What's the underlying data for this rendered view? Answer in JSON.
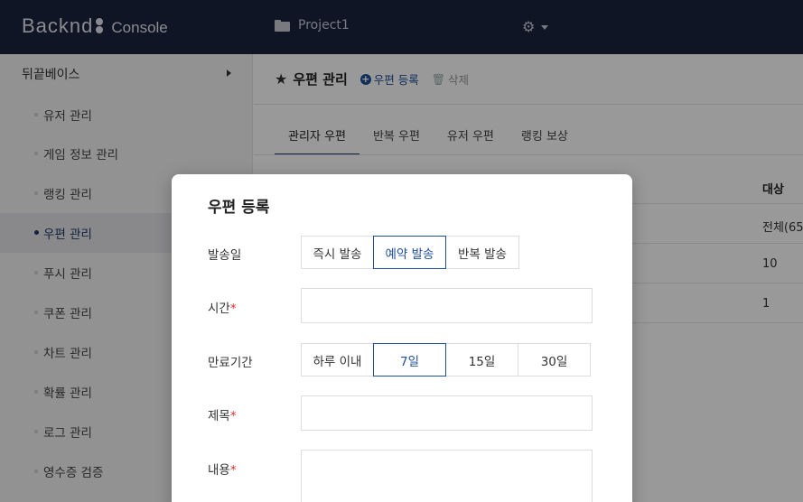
{
  "topbar": {
    "logo_text": "Backnd",
    "console_text": "Console",
    "project_name": "Project1",
    "icons": [
      "folder-icon",
      "gear-icon",
      "caret-down-icon"
    ]
  },
  "sidebar": {
    "group_label": "뒤끝베이스",
    "items": [
      {
        "label": "유저 관리"
      },
      {
        "label": "게임 정보 관리"
      },
      {
        "label": "랭킹 관리"
      },
      {
        "label": "우편 관리",
        "active": true
      },
      {
        "label": "푸시 관리"
      },
      {
        "label": "쿠폰 관리"
      },
      {
        "label": "차트 관리"
      },
      {
        "label": "확률 관리"
      },
      {
        "label": "로그 관리"
      },
      {
        "label": "영수증 검증"
      }
    ]
  },
  "header": {
    "title": "우편 관리",
    "register_label": "우편 등록",
    "delete_label": "삭제"
  },
  "tabs": [
    "관리자 우편",
    "반복 우편",
    "유저 우편",
    "랭킹 보상"
  ],
  "table": {
    "column_header": "대상",
    "rows": [
      "전체(65",
      "10",
      "1"
    ]
  },
  "modal": {
    "title": "우편 등록",
    "send_date": {
      "label": "발송일",
      "options": [
        "즉시 발송",
        "예약 발송",
        "반복 발송"
      ],
      "selected": "예약 발송"
    },
    "time": {
      "label": "시간",
      "required_mark": "*",
      "value": ""
    },
    "expiry": {
      "label": "만료기간",
      "options": [
        "하루 이내",
        "7일",
        "15일",
        "30일"
      ],
      "selected": "7일"
    },
    "subject": {
      "label": "제목",
      "required_mark": "*",
      "value": ""
    },
    "content": {
      "label": "내용",
      "required_mark": "*",
      "value": ""
    }
  },
  "colors": {
    "topbar_bg": "#1b2340",
    "accent": "#1f4f9a",
    "required": "#d33333"
  }
}
